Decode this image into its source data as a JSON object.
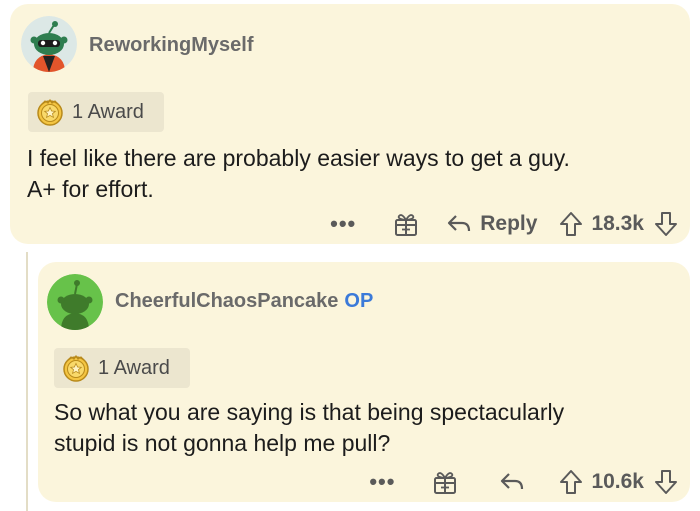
{
  "comments": [
    {
      "username": "ReworkingMyself",
      "op": "",
      "award_label": "1 Award",
      "text_lines": [
        "I feel like there are probably easier ways to get a guy.",
        "A+ for effort."
      ],
      "more": "•••",
      "reply_label": "Reply",
      "score": "18.3k"
    },
    {
      "username": "CheerfulChaosPancake",
      "op": "OP",
      "award_label": "1 Award",
      "text_lines": [
        "So what you are saying is that being spectacularly",
        "stupid is not gonna help me pull?"
      ],
      "more": "•••",
      "reply_label": "",
      "score": "10.6k"
    }
  ],
  "colors": {
    "card_bg": "#fbf5dc",
    "op_blue": "#3b7ad9",
    "avatar1_bg": "#dce8e6",
    "avatar1_body": "#2e7d4f",
    "avatar2_bg": "#67c24a",
    "avatar2_body": "#3f7b2b"
  },
  "icons": [
    "avatar-snoo-icon",
    "award-icon",
    "more-icon",
    "gift-icon",
    "reply-arrow-icon",
    "upvote-icon",
    "downvote-icon"
  ]
}
